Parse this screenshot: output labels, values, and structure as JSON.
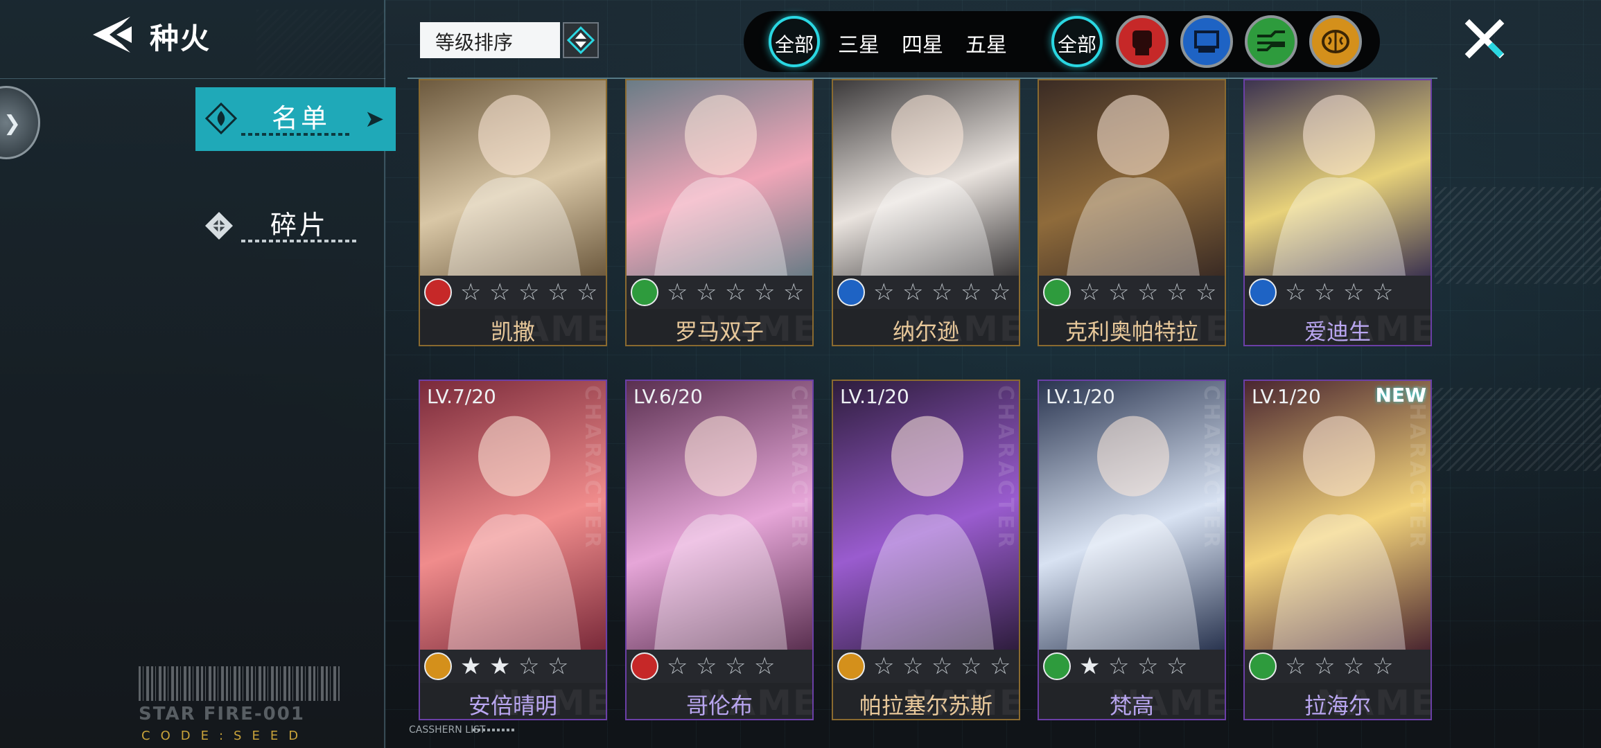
{
  "header": {
    "title": "种火",
    "back_icon": "back-arrow-icon",
    "close_icon": "close-x-icon"
  },
  "left_nav": {
    "tabs": [
      {
        "label": "名单",
        "selected": true,
        "icon": "flame-diamond-icon"
      },
      {
        "label": "碎片",
        "selected": false,
        "icon": "shard-diamond-icon"
      }
    ],
    "side_button_icon": "chevron-right-icon"
  },
  "footer": {
    "code_name": "STAR FIRE-001",
    "code_seed": "CODE:SEED",
    "list_label": "CASSHERN LIST"
  },
  "sort": {
    "label": "等级排序",
    "toggle_icon": "sort-toggle-icon"
  },
  "filter": {
    "rarity": [
      {
        "label": "全部",
        "selected": true
      },
      {
        "label": "三星",
        "selected": false
      },
      {
        "label": "四星",
        "selected": false
      },
      {
        "label": "五星",
        "selected": false
      }
    ],
    "attribute": [
      {
        "label": "全部",
        "selected": true
      },
      {
        "icon": "fist-icon",
        "color": "#c62828"
      },
      {
        "icon": "chip-icon",
        "color": "#1e63c4"
      },
      {
        "icon": "circuit-icon",
        "color": "#2e9b3d"
      },
      {
        "icon": "brain-icon",
        "color": "#d4901b"
      }
    ]
  },
  "card_common": {
    "bg_word": "NAME",
    "side_word": "CHARACTER"
  },
  "cards": [
    {
      "name": "凯撒",
      "level": "",
      "attr": "fist-icon",
      "attr_color": "#c62828",
      "stars_filled": 0,
      "stars_total": 5,
      "frame": "gold",
      "new": false
    },
    {
      "name": "罗马双子",
      "level": "",
      "attr": "circuit-icon",
      "attr_color": "#2e9b3d",
      "stars_filled": 0,
      "stars_total": 5,
      "frame": "gold",
      "new": false
    },
    {
      "name": "纳尔逊",
      "level": "",
      "attr": "chip-icon",
      "attr_color": "#1e63c4",
      "stars_filled": 0,
      "stars_total": 5,
      "frame": "gold",
      "new": false
    },
    {
      "name": "克利奥帕特拉",
      "level": "",
      "attr": "circuit-icon",
      "attr_color": "#2e9b3d",
      "stars_filled": 0,
      "stars_total": 5,
      "frame": "gold",
      "new": false
    },
    {
      "name": "爱迪生",
      "level": "",
      "attr": "chip-icon",
      "attr_color": "#1e63c4",
      "stars_filled": 0,
      "stars_total": 4,
      "frame": "purple",
      "new": false
    },
    {
      "name": "安倍晴明",
      "level": "LV.7/20",
      "attr": "brain-icon",
      "attr_color": "#d4901b",
      "stars_filled": 2,
      "stars_total": 4,
      "frame": "purple",
      "new": false
    },
    {
      "name": "哥伦布",
      "level": "LV.6/20",
      "attr": "fist-icon",
      "attr_color": "#c62828",
      "stars_filled": 0,
      "stars_total": 4,
      "frame": "purple",
      "new": false
    },
    {
      "name": "帕拉塞尔苏斯",
      "level": "LV.1/20",
      "attr": "brain-icon",
      "attr_color": "#d4901b",
      "stars_filled": 0,
      "stars_total": 5,
      "frame": "gold",
      "new": false
    },
    {
      "name": "梵高",
      "level": "LV.1/20",
      "attr": "circuit-icon",
      "attr_color": "#2e9b3d",
      "stars_filled": 1,
      "stars_total": 4,
      "frame": "purple",
      "new": false
    },
    {
      "name": "拉海尔",
      "level": "LV.1/20",
      "attr": "circuit-icon",
      "attr_color": "#2e9b3d",
      "stars_filled": 0,
      "stars_total": 4,
      "frame": "purple",
      "new": true,
      "new_label": "NEW"
    }
  ]
}
